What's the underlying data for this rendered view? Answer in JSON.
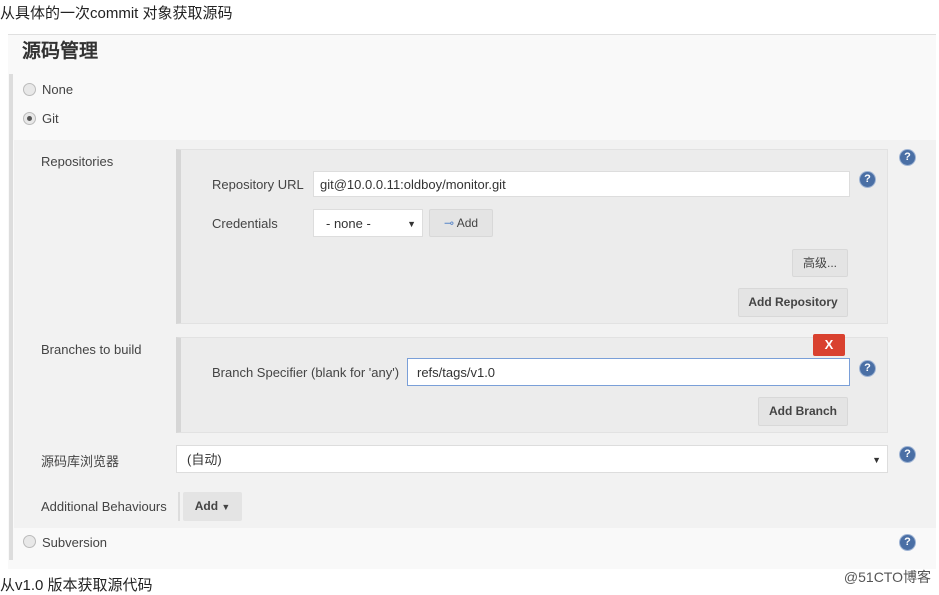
{
  "captions": {
    "top": "从具体的一次commit 对象获取源码",
    "bottom": "从v1.0 版本获取源代码",
    "watermark": "@51CTO博客"
  },
  "section_title": "源码管理",
  "scm_options": [
    {
      "label": "None",
      "selected": false
    },
    {
      "label": "Git",
      "selected": true
    },
    {
      "label": "Subversion",
      "selected": false
    }
  ],
  "repositories": {
    "label": "Repositories",
    "url_label": "Repository URL",
    "url_value": "git@10.0.0.11:oldboy/monitor.git",
    "credentials_label": "Credentials",
    "credentials_value": "- none -",
    "add_label": "Add",
    "advanced_label": "高级...",
    "add_repository_label": "Add Repository"
  },
  "branches": {
    "label": "Branches to build",
    "delete_label": "X",
    "specifier_label": "Branch Specifier (blank for 'any')",
    "specifier_value": "refs/tags/v1.0",
    "add_branch_label": "Add Branch"
  },
  "browser": {
    "label": "源码库浏览器",
    "value": "(自动)"
  },
  "behaviours": {
    "label": "Additional Behaviours",
    "add_label": "Add"
  },
  "help_glyph": "?",
  "colors": {
    "delete_button": "#d9412f",
    "help_icon": "#4a6fa5",
    "focus_border": "#7a9fd8"
  }
}
